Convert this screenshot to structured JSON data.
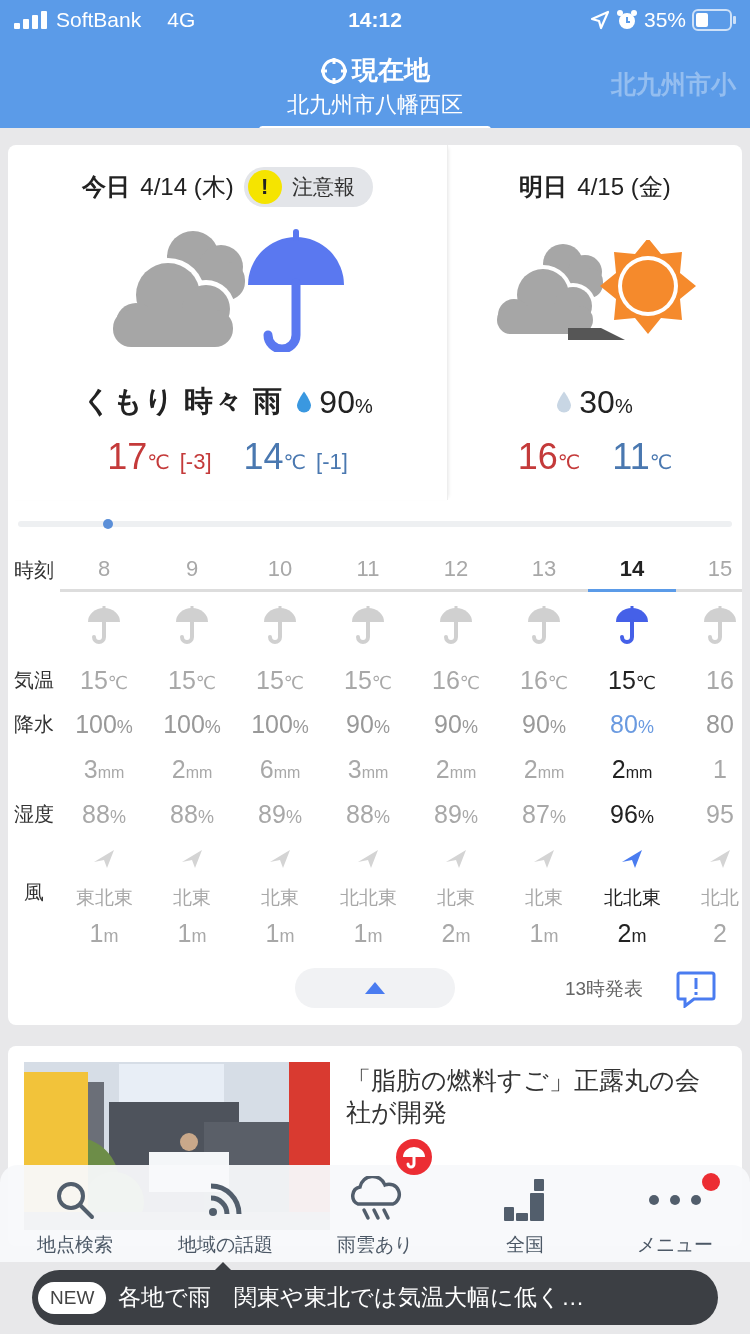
{
  "status_bar": {
    "carrier": "SoftBank",
    "network": "4G",
    "time": "14:12",
    "battery": "35%"
  },
  "header": {
    "title": "現在地",
    "location": "北九州市八幡西区",
    "next_location": "北九州市小"
  },
  "days": [
    {
      "label": "今日",
      "date": "4/14 (木)",
      "warning": {
        "mark": "!",
        "label": "注意報"
      },
      "weather": "くもり 時々 雨",
      "precipitation": "90%",
      "high": "17℃",
      "high_diff": "[-3]",
      "low": "14℃",
      "low_diff": "[-1]"
    },
    {
      "label": "明日",
      "date": "4/15 (金)",
      "precipitation": "30%",
      "high": "16℃",
      "low": "11℃"
    }
  ],
  "hourly": {
    "row_labels": {
      "time": "時刻",
      "temperature": "気温",
      "precipitation": "降水",
      "humidity": "湿度",
      "wind": "風"
    },
    "hours": [
      {
        "hour": "8",
        "selected": false,
        "temperature": "15℃",
        "precipitation": "100%",
        "rainfall": "3mm",
        "humidity": "88%",
        "wind_direction": "東北東",
        "wind_speed": "1m"
      },
      {
        "hour": "9",
        "selected": false,
        "temperature": "15℃",
        "precipitation": "100%",
        "rainfall": "2mm",
        "humidity": "88%",
        "wind_direction": "北東",
        "wind_speed": "1m"
      },
      {
        "hour": "10",
        "selected": false,
        "temperature": "15℃",
        "precipitation": "100%",
        "rainfall": "6mm",
        "humidity": "89%",
        "wind_direction": "北東",
        "wind_speed": "1m"
      },
      {
        "hour": "11",
        "selected": false,
        "temperature": "15℃",
        "precipitation": "90%",
        "rainfall": "3mm",
        "humidity": "88%",
        "wind_direction": "北北東",
        "wind_speed": "1m"
      },
      {
        "hour": "12",
        "selected": false,
        "temperature": "16℃",
        "precipitation": "90%",
        "rainfall": "2mm",
        "humidity": "89%",
        "wind_direction": "北東",
        "wind_speed": "2m"
      },
      {
        "hour": "13",
        "selected": false,
        "temperature": "16℃",
        "precipitation": "90%",
        "rainfall": "2mm",
        "humidity": "87%",
        "wind_direction": "北東",
        "wind_speed": "1m"
      },
      {
        "hour": "14",
        "selected": true,
        "temperature": "15℃",
        "precipitation": "80%",
        "rainfall": "2mm",
        "humidity": "96%",
        "wind_direction": "北北東",
        "wind_speed": "2m"
      },
      {
        "hour": "15",
        "selected": false,
        "temperature": "16",
        "precipitation": "80",
        "rainfall": "1",
        "humidity": "95",
        "wind_direction": "北北",
        "wind_speed": "2"
      }
    ],
    "published": "13時発表"
  },
  "news": {
    "kind": "picture",
    "headline": "「脂肪の燃料すご」正露丸の会社が開発"
  },
  "tab_bar": [
    {
      "label": "地点検索",
      "kind": "plain"
    },
    {
      "label": "地域の話題",
      "kind": "plain"
    },
    {
      "label": "雨雲あり",
      "kind": "alert"
    },
    {
      "label": "全国",
      "kind": "plain"
    },
    {
      "label": "メニュー",
      "kind": "notice"
    }
  ],
  "ticker": {
    "tag": "NEW",
    "text": "各地で雨　関東や東北では気温大幅に低く…"
  }
}
